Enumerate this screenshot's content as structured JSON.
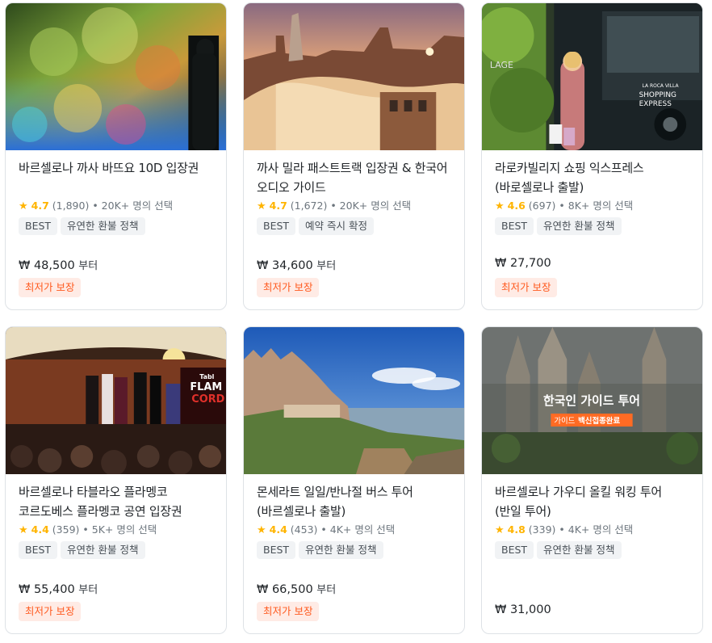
{
  "products": [
    {
      "title": "바르셀로나 까사 바뜨요 10D 입장권",
      "star": "★",
      "score": "4.7",
      "reviews": "(1,890)",
      "chosen": "• 20K+ 명의 선택",
      "tags": [
        "BEST",
        "유연한 환불 정책"
      ],
      "price": "₩ 48,500",
      "price_suffix": "부터",
      "badge": "최저가 보장",
      "image": "immersive-art-gallery"
    },
    {
      "title": "까사 밀라 패스트트랙 입장권 & 한국어 오디오 가이드",
      "star": "★",
      "score": "4.7",
      "reviews": "(1,672)",
      "chosen": "• 20K+ 명의 선택",
      "tags": [
        "BEST",
        "예약 즉시 확정"
      ],
      "price": "₩ 34,600",
      "price_suffix": "부터",
      "badge": "최저가 보장",
      "image": "casa-mila-rooftop"
    },
    {
      "title": "라로카빌리지 쇼핑 익스프레스 (바로셀로나 출발)",
      "star": "★",
      "score": "4.6",
      "reviews": "(697)",
      "chosen": "• 8K+ 명의 선택",
      "tags": [
        "BEST",
        "유연한 환불 정책"
      ],
      "price": "₩ 27,700",
      "price_suffix": "",
      "badge": "최저가 보장",
      "image": "shopping-bus",
      "image_text": [
        "LAGE",
        "LA ROCA VILLA",
        "SHOPPING",
        "EXPRESS"
      ]
    },
    {
      "title": "바르셀로나 타블라오 플라멩코 코르도베스 플라멩코 공연 입장권",
      "star": "★",
      "score": "4.4",
      "reviews": "(359)",
      "chosen": "• 5K+ 명의 선택",
      "tags": [
        "BEST",
        "유연한 환불 정책"
      ],
      "price": "₩ 55,400",
      "price_suffix": "부터",
      "badge": "최저가 보장",
      "image": "flamenco-show",
      "image_text": [
        "Tabl",
        "FLAM",
        "CORD"
      ]
    },
    {
      "title": "몬세라트 일일/반나절 버스 투어 (바르셀로나 출발)",
      "star": "★",
      "score": "4.4",
      "reviews": "(453)",
      "chosen": "• 4K+ 명의 선택",
      "tags": [
        "BEST",
        "유연한 환불 정책"
      ],
      "price": "₩ 66,500",
      "price_suffix": "부터",
      "badge": "최저가 보장",
      "image": "montserrat-mountain"
    },
    {
      "title": "바르셀로나 가우디 올킬 워킹 투어 (반일 투어)",
      "star": "★",
      "score": "4.8",
      "reviews": "(339)",
      "chosen": "• 4K+ 명의 선택",
      "tags": [
        "BEST",
        "유연한 환불 정책"
      ],
      "price": "₩ 31,000",
      "price_suffix": "",
      "badge": "",
      "image": "sagrada-familia",
      "image_text": [
        "한국인 가이드 투어",
        "가이드",
        "백신접종완료"
      ]
    }
  ],
  "colors": {
    "star": "#ffb400",
    "badge_bg": "#ffebe5",
    "badge_text": "#ff5a1f",
    "tag_bg": "#f1f3f5"
  }
}
